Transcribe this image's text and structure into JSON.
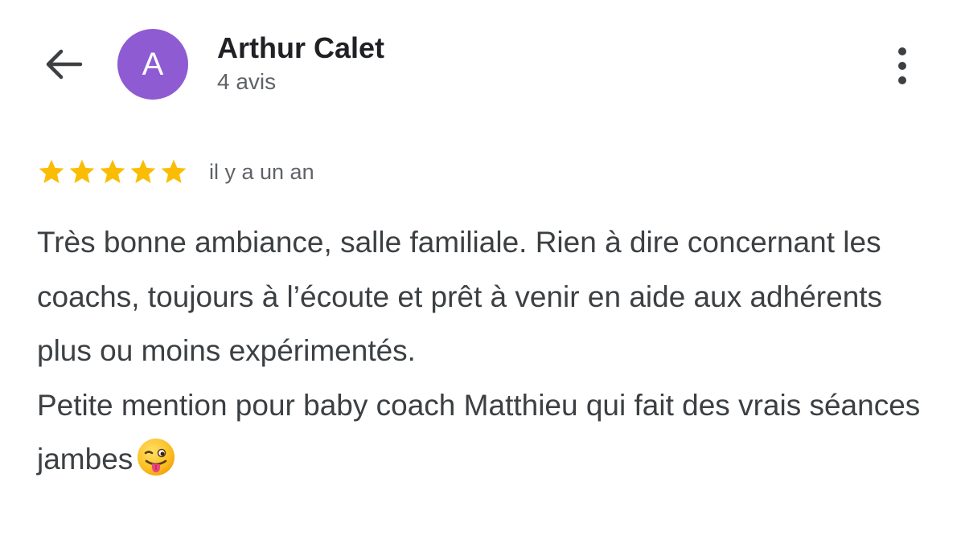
{
  "header": {
    "back_icon": "arrow-back-icon",
    "more_icon": "more-vertical-icon"
  },
  "author": {
    "initial": "A",
    "avatar_color": "#8e5bd3",
    "name": "Arthur Calet",
    "review_count": "4 avis"
  },
  "review": {
    "rating": 5,
    "max_rating": 5,
    "star_color": "#fbbc04",
    "time_ago": "il y a un an",
    "paragraph_1": "Très bonne ambiance, salle familiale. Rien à dire concernant les coachs, toujours à l’écoute et prêt à venir en aide aux adhérents plus ou moins expérimentés.",
    "paragraph_2": "Petite mention pour baby coach Matthieu qui fait des vrais séances jambes",
    "emoji_icon": "winking-face-with-tongue-icon"
  }
}
